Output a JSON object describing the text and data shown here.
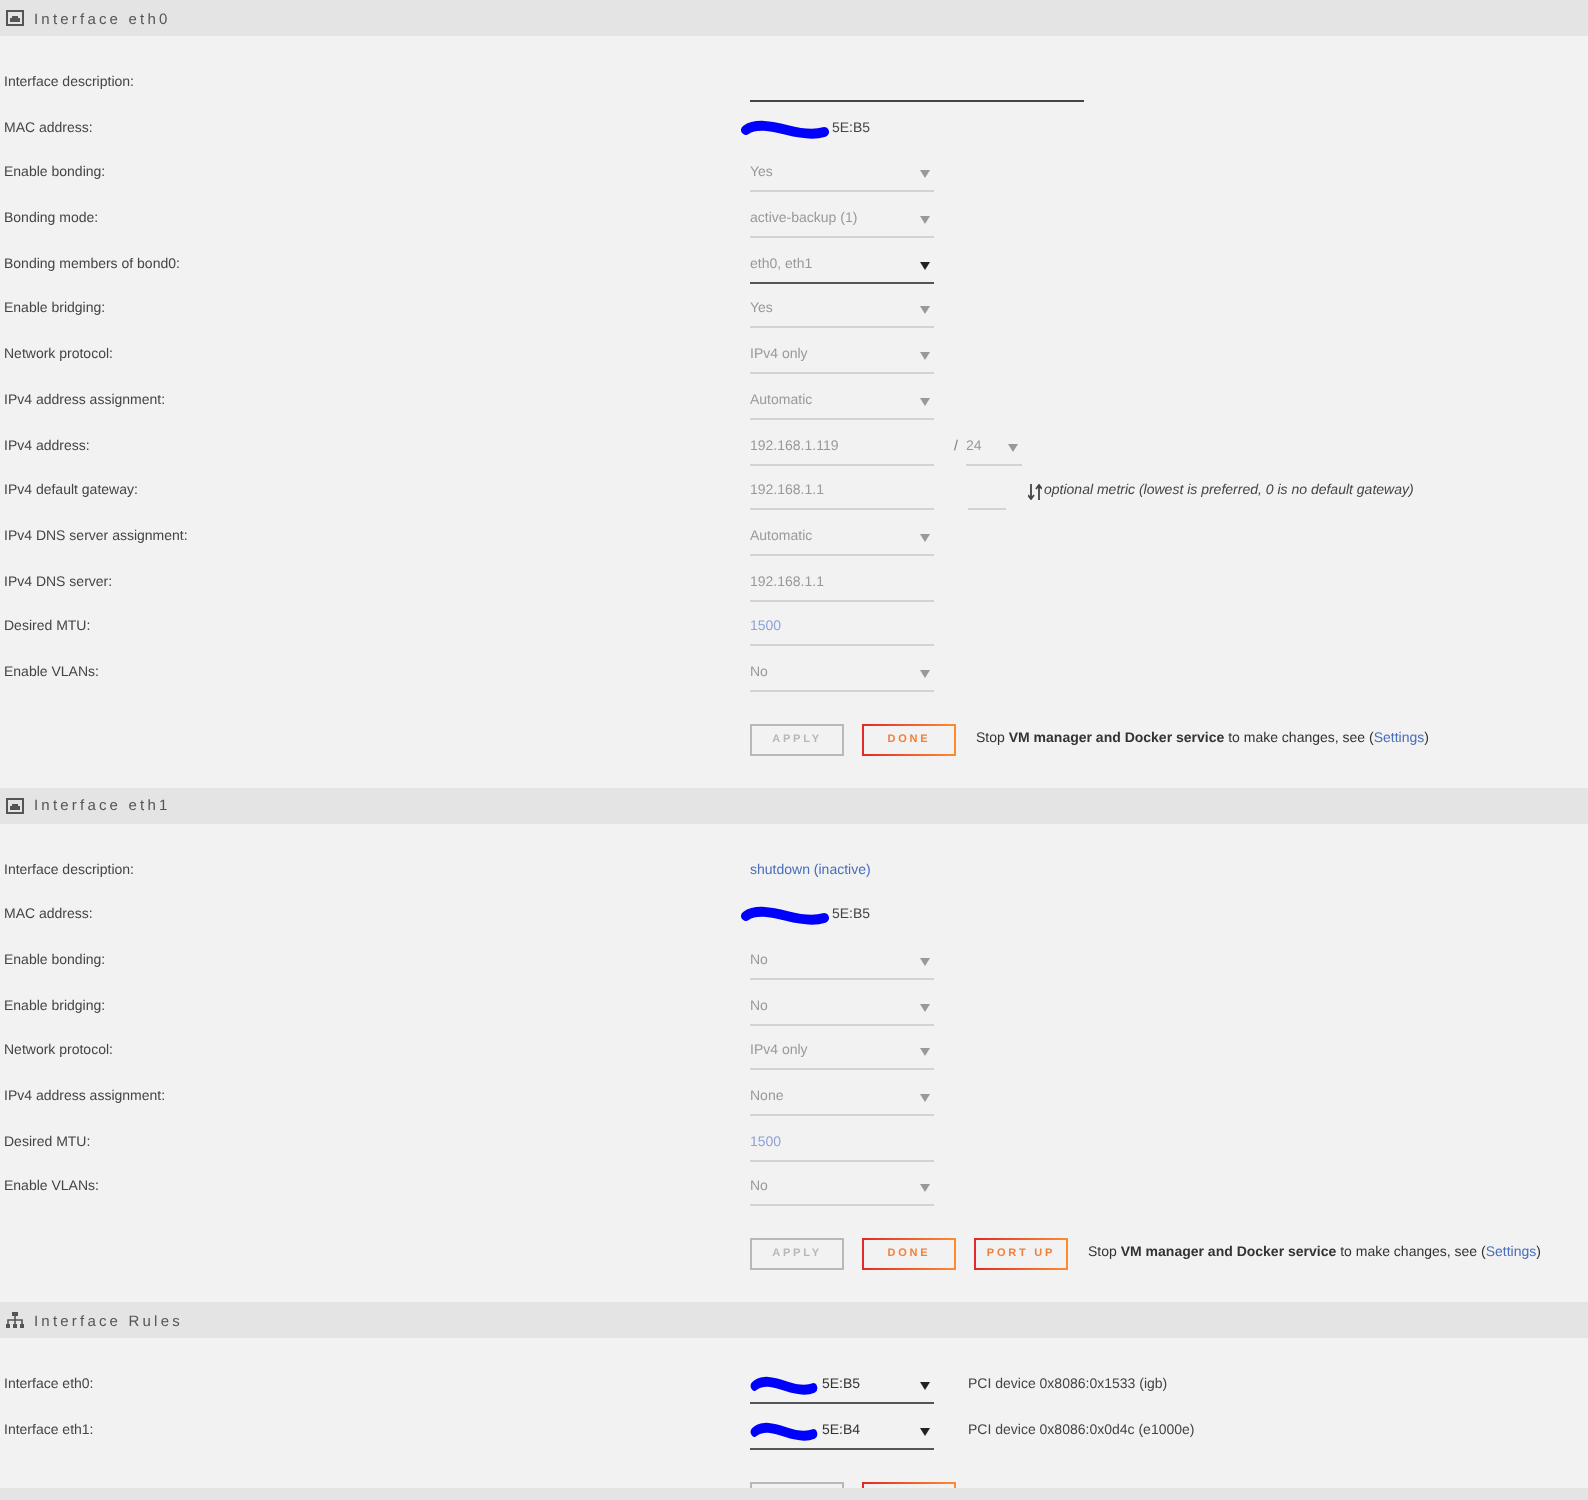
{
  "sections": [
    {
      "title": "Interface eth0",
      "kind": "interface",
      "rows": [
        {
          "label": "Interface description:",
          "kind": "wideinput",
          "disabled": false
        },
        {
          "label": "MAC address:",
          "kind": "mac",
          "value": "5E:B5",
          "redacted": true
        },
        {
          "label": "Enable bonding:",
          "kind": "select",
          "value": "Yes",
          "disabled": true
        },
        {
          "label": "Bonding mode:",
          "kind": "select",
          "value": "active-backup (1)",
          "disabled": true
        },
        {
          "label": "Bonding members of bond0:",
          "kind": "multiselect",
          "value": "eth0, eth1",
          "disabled": false
        },
        {
          "label": "Enable bridging:",
          "kind": "select",
          "value": "Yes",
          "disabled": true
        },
        {
          "label": "Network protocol:",
          "kind": "select",
          "value": "IPv4 only",
          "disabled": true
        },
        {
          "label": "IPv4 address assignment:",
          "kind": "select",
          "value": "Automatic",
          "disabled": true
        },
        {
          "label": "IPv4 address:",
          "kind": "address",
          "value": "192.168.1.119",
          "disabled": true,
          "separator": "/",
          "prefix": "24"
        },
        {
          "label": "IPv4 default gateway:",
          "kind": "gateway",
          "value": "192.168.1.1",
          "disabled": true,
          "note": "optional metric (lowest is preferred, 0 is no default gateway)"
        },
        {
          "label": "IPv4 DNS server assignment:",
          "kind": "select",
          "value": "Automatic",
          "disabled": true
        },
        {
          "label": "IPv4 DNS server:",
          "kind": "input",
          "value": "192.168.1.1",
          "disabled": true
        },
        {
          "label": "Desired MTU:",
          "kind": "input",
          "placeholder": "1500",
          "disabled": true
        },
        {
          "label": "Enable VLANs:",
          "kind": "select",
          "value": "No",
          "disabled": true
        }
      ],
      "buttons": [
        {
          "label": "APPLY",
          "disabled": true
        },
        {
          "label": "DONE",
          "disabled": false
        }
      ],
      "note": {
        "text": "Stop **VM manager and Docker service** to make changes, see (",
        "link": "Settings",
        "tail": ")"
      }
    },
    {
      "title": "Interface eth1",
      "kind": "interface",
      "rows": [
        {
          "label": "Interface description:",
          "kind": "status",
          "value": "shutdown (inactive)"
        },
        {
          "label": "MAC address:",
          "kind": "mac",
          "value": "5E:B5",
          "redacted": true
        },
        {
          "label": "Enable bonding:",
          "kind": "select",
          "value": "No",
          "disabled": true
        },
        {
          "label": "Enable bridging:",
          "kind": "select",
          "value": "No",
          "disabled": true
        },
        {
          "label": "Network protocol:",
          "kind": "select",
          "value": "IPv4 only",
          "disabled": true
        },
        {
          "label": "IPv4 address assignment:",
          "kind": "select",
          "value": "None",
          "disabled": true
        },
        {
          "label": "Desired MTU:",
          "kind": "input",
          "placeholder": "1500",
          "disabled": true
        },
        {
          "label": "Enable VLANs:",
          "kind": "select",
          "value": "No",
          "disabled": true
        }
      ],
      "buttons": [
        {
          "label": "APPLY",
          "disabled": true
        },
        {
          "label": "DONE",
          "disabled": false
        },
        {
          "label": "PORT UP",
          "disabled": false
        }
      ],
      "note": {
        "text": "Stop **VM manager and Docker service** to make changes, see (",
        "link": "Settings",
        "tail": ")"
      }
    },
    {
      "title": "Interface Rules",
      "kind": "rules",
      "rows": [
        {
          "label": "Interface eth0:",
          "kind": "macselect",
          "value": "5E:B5",
          "redacted": true,
          "disabled": false,
          "device": "PCI device 0x8086:0x1533 (igb)"
        },
        {
          "label": "Interface eth1:",
          "kind": "macselect",
          "value": "5E:B4",
          "redacted": true,
          "disabled": false,
          "device": "PCI device 0x8086:0x0d4c (e1000e)"
        }
      ],
      "buttons": [
        {
          "disabled": true
        },
        {
          "disabled": false
        }
      ]
    }
  ]
}
